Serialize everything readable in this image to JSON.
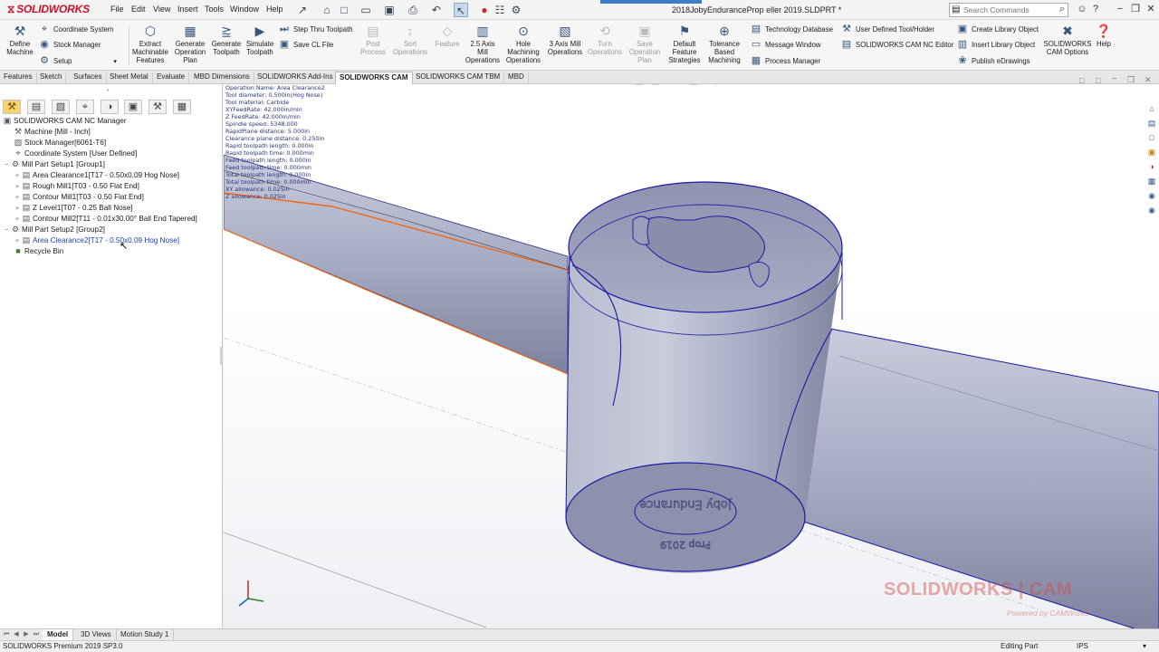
{
  "app": {
    "brand": "SOLIDWORKS",
    "doc_title": "2018JobyEnduranceProp eller 2019.SLDPRT *",
    "menus": [
      "File",
      "Edit",
      "View",
      "Insert",
      "Tools",
      "Window",
      "Help"
    ],
    "search_placeholder": "Search Commands"
  },
  "commands": {
    "define_machine": "Define\nMachine",
    "coordinate_system": "Coordinate System",
    "stock_manager": "Stock Manager",
    "setup": "Setup",
    "extract": "Extract\nMachinable\nFeatures",
    "gen_plan": "Generate\nOperation\nPlan",
    "gen_toolpath": "Generate\nToolpath",
    "simulate": "Simulate\nToolpath",
    "step_thru": "Step Thru Toolpath",
    "save_cl": "Save CL File",
    "post": "Post\nProcess",
    "sort": "Sort\nOperations",
    "feature": "Feature",
    "axis25": "2.5 Axis\nMill\nOperations",
    "hole": "Hole\nMachining\nOperations",
    "axis3": "3 Axis Mill\nOperations",
    "turn": "Turn\nOperations",
    "save_op": "Save\nOperation\nPlan",
    "default_feat": "Default\nFeature\nStrategies",
    "tolerance": "Tolerance\nBased\nMachining",
    "tech_db": "Technology Database",
    "msg_window": "Message Window",
    "process_mgr": "Process Manager",
    "user_tool": "User Defined Tool/Holder",
    "nc_editor": "SOLIDWORKS CAM NC Editor",
    "create_lib": "Create Library Object",
    "insert_lib": "Insert Library Object",
    "publish": "Publish eDrawings",
    "cam_options": "SOLIDWORKS\nCAM Options",
    "help": "Help"
  },
  "tabs": [
    "Features",
    "Sketch",
    "Surfaces",
    "Sheet Metal",
    "Evaluate",
    "MBD Dimensions",
    "SOLIDWORKS Add-Ins",
    "SOLIDWORKS CAM",
    "SOLIDWORKS CAM TBM",
    "MBD"
  ],
  "active_tab": "SOLIDWORKS CAM",
  "tree": {
    "root": "SOLIDWORKS CAM NC Manager",
    "machine": "Machine [Mill - Inch]",
    "stock": "Stock Manager[6061-T6]",
    "coord": "Coordinate System [User Defined]",
    "setup1": "Mill Part Setup1 [Group1]",
    "op1": "Area Clearance1[T17 - 0.50x0.09 Hog Nose]",
    "op2": "Rough Mill1[T03 - 0.50 Flat End]",
    "op3": "Contour Mill1[T03 - 0.50 Flat End]",
    "op4": "Z Level1[T07 - 0.25 Ball Nose]",
    "op5": "Contour Mill2[T11 - 0.01x30.00° Ball End Tapered]",
    "setup2": "Mill Part Setup2 [Group2]",
    "op6": "Area Clearance2[T17 - 0.50x0.09 Hog Nose]",
    "recycle": "Recycle Bin"
  },
  "op_info": [
    "Operation Name: Area Clearance2",
    "Tool diameter: 0.500in(Hog Nose)",
    "Tool material: Carbide",
    "XYFeedRate: 42.000in/min",
    "Z FeedRate: 42.000in/min",
    "Spindle speed: 5348.000",
    "RapidPlane distance: 5.000in",
    "Clearance plane distance: 0.250in",
    "Rapid toolpath length: 0.000in",
    "Rapid toolpath time: 0.000min",
    "Feed toolpath length: 0.000in",
    "Feed toolpath time: 0.000min",
    "Total toolpath length: 0.000in",
    "Total toolpath time: 0.000min",
    "XY allowance: 0.025in",
    "Z allowance: 0.025in"
  ],
  "watermark": {
    "main": "SOLIDWORKS | CAM",
    "sub": "Powered by CAMWorks"
  },
  "bottom_tabs": [
    "Model",
    "3D Views",
    "Motion Study 1"
  ],
  "status": {
    "left": "SOLIDWORKS Premium 2019 SP3.0",
    "mode": "Editing Part",
    "units": "IPS"
  },
  "colors": {
    "part_fill": "#a3a7c0",
    "part_edge": "#1a1aa0",
    "toolpath": "#ec6a1a",
    "accent": "#c8102e"
  }
}
